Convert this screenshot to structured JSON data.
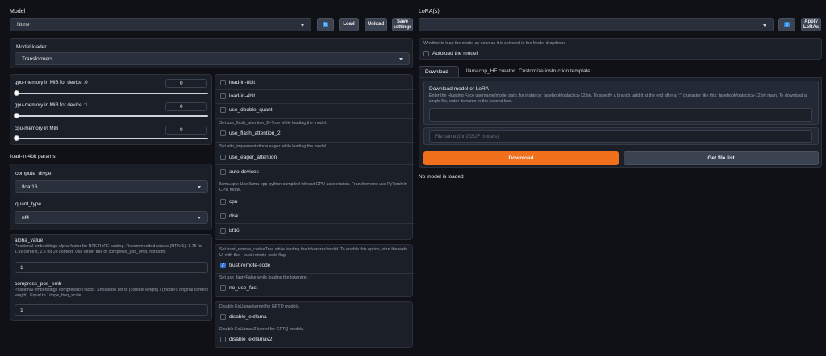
{
  "left": {
    "model_label": "Model",
    "model_value": "None",
    "load_btn": "Load",
    "unload_btn": "Unload",
    "save_btn": "Save settings",
    "loader_label": "Model loader",
    "loader_value": "Transformers",
    "gpu0_label": "gpu-memory in MiB for device :0",
    "gpu0_value": "0",
    "gpu1_label": "gpu-memory in MiB for device :1",
    "gpu1_value": "0",
    "cpu_label": "cpu-memory in MiB",
    "cpu_value": "0",
    "four_bit_label": "load-in-4bit params:",
    "compute_label": "compute_dtype",
    "compute_value": "float16",
    "quant_label": "quant_type",
    "quant_value": "nf4",
    "alpha_label": "alpha_value",
    "alpha_info": "Positional embeddings alpha factor for NTK RoPE scaling. Recommended values (NTKv1): 1.75 for 1.5x context, 2.5 for 2x context. Use either this or compress_pos_emb, not both.",
    "alpha_value": "1",
    "compress_label": "compress_pos_emb",
    "compress_info": "Positional embeddings compression factor. Should be set to (context length) / (model's original context length). Equal to 1/rope_freq_scale.",
    "compress_value": "1"
  },
  "mid": {
    "load8": "load-in-8bit",
    "load4": "load-in-4bit",
    "double_quant": "use_double_quant",
    "flash_info": "Set use_flash_attention_2=True while loading the model.",
    "flash": "use_flash_attention_2",
    "eager_info": "Set attn_implementation= eager while loading the model.",
    "eager": "use_eager_attention",
    "auto_devices": "auto-devices",
    "cpu_info": "llama.cpp: Use llama-cpp-python compiled without GPU acceleration. Transformers: use PyTorch in CPU mode.",
    "cpu": "cpu",
    "disk": "disk",
    "bf16": "bf16",
    "trust_info": "Set trust_remote_code=True while loading the tokenizer/model. To enable this option, start the web UI with the --trust-remote-code flag.",
    "trust": "trust-remote-code",
    "fast_info": "Set use_fast=False while loading the tokenizer.",
    "no_fast": "no_use_fast",
    "exllama_info": "Disable ExLlama kernel for GPTQ models.",
    "exllama": "disable_exllama",
    "exllamav2_info": "Disable ExLlamav2 kernel for GPTQ models.",
    "exllamav2": "disable_exllamav2"
  },
  "right": {
    "lora_label": "LoRA(s)",
    "apply_btn": "Apply LoRAs",
    "autoload_info": "Whether to load the model as soon as it is selected in the Model dropdown.",
    "autoload": "Autoload the model",
    "tabs": [
      "Download",
      "llamacpp_HF creator",
      "Customize instruction template"
    ],
    "dl_title": "Download model or LoRA",
    "dl_info": "Enter the Hugging Face username/model path, for instance: facebook/galactica-125m. To specify a branch, add it at the end after a \":\" character like this: facebook/galactica-125m:main. To download a single file, enter its name in the second box.",
    "file_placeholder": "File name (for GGUF models)",
    "download_btn": "Download",
    "getfile_btn": "Get file list",
    "status": "No model is loaded"
  },
  "colors": {
    "accent": "#f0701c",
    "check": "#2f6fd6",
    "refresh": "#2f8be0"
  }
}
